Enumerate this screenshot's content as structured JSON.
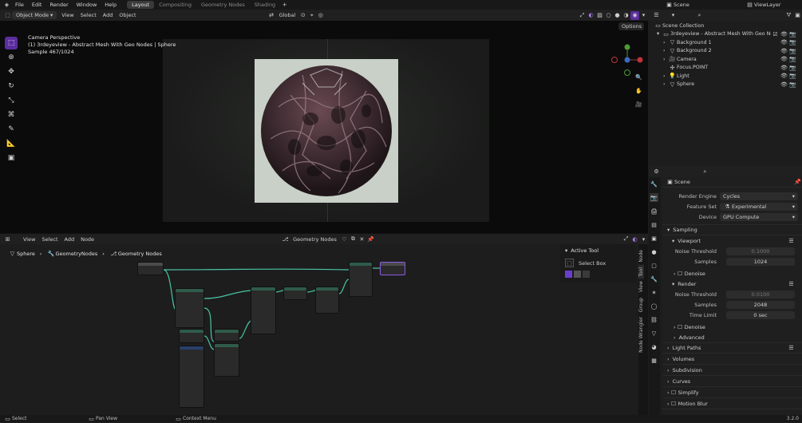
{
  "menubar": {
    "menus": [
      "File",
      "Edit",
      "Render",
      "Window",
      "Help"
    ],
    "tabs": [
      "Layout",
      "Compositing",
      "Geometry Nodes",
      "Shading"
    ],
    "active_tab": "Layout",
    "scene": "Scene",
    "view_layer": "ViewLayer"
  },
  "viewport": {
    "mode": "Object Mode",
    "menu": [
      "View",
      "Select",
      "Add",
      "Object"
    ],
    "transform": "Global",
    "options": "Options",
    "info_line1": "Camera Perspective",
    "info_line2": "(1) 3rdeyeview - Abstract Mesh With Geo Nodes | Sphere",
    "info_line3": "Sample 467/1024"
  },
  "node_editor": {
    "menu": [
      "View",
      "Select",
      "Add",
      "Node"
    ],
    "tree": "Geometry Nodes",
    "breadcrumb": [
      "Sphere",
      "GeometryNodes",
      "Geometry Nodes"
    ],
    "active_tool_title": "Active Tool",
    "active_tool": "Select Box",
    "side_tabs": [
      "Node",
      "Tool",
      "View",
      "Group",
      "Node Wrangler"
    ]
  },
  "outliner": {
    "root": "Scene Collection",
    "collection": "3rdeyeview - Abstract Mesh With Geo Nodes",
    "items": [
      "Background 1",
      "Background 2",
      "Camera",
      "Focus.POINT",
      "Light",
      "Sphere"
    ]
  },
  "properties": {
    "context": "Scene",
    "render_engine_label": "Render Engine",
    "render_engine": "Cycles",
    "feature_set_label": "Feature Set",
    "feature_set": "Experimental",
    "device_label": "Device",
    "device": "GPU Compute",
    "sampling": "Sampling",
    "viewport": "Viewport",
    "noise_threshold_label": "Noise Threshold",
    "viewport_noise": "0.1000",
    "samples_label": "Samples",
    "viewport_samples": "1024",
    "denoise": "Denoise",
    "render": "Render",
    "render_noise": "0.0100",
    "render_samples": "2048",
    "time_limit_label": "Time Limit",
    "time_limit": "0 sec",
    "advanced": "Advanced",
    "sections": [
      "Light Paths",
      "Volumes",
      "Subdivision",
      "Curves",
      "Simplify",
      "Motion Blur"
    ]
  },
  "statusbar": {
    "select": "Select",
    "pan": "Pan View",
    "context": "Context Menu",
    "version": "3.2.0"
  }
}
